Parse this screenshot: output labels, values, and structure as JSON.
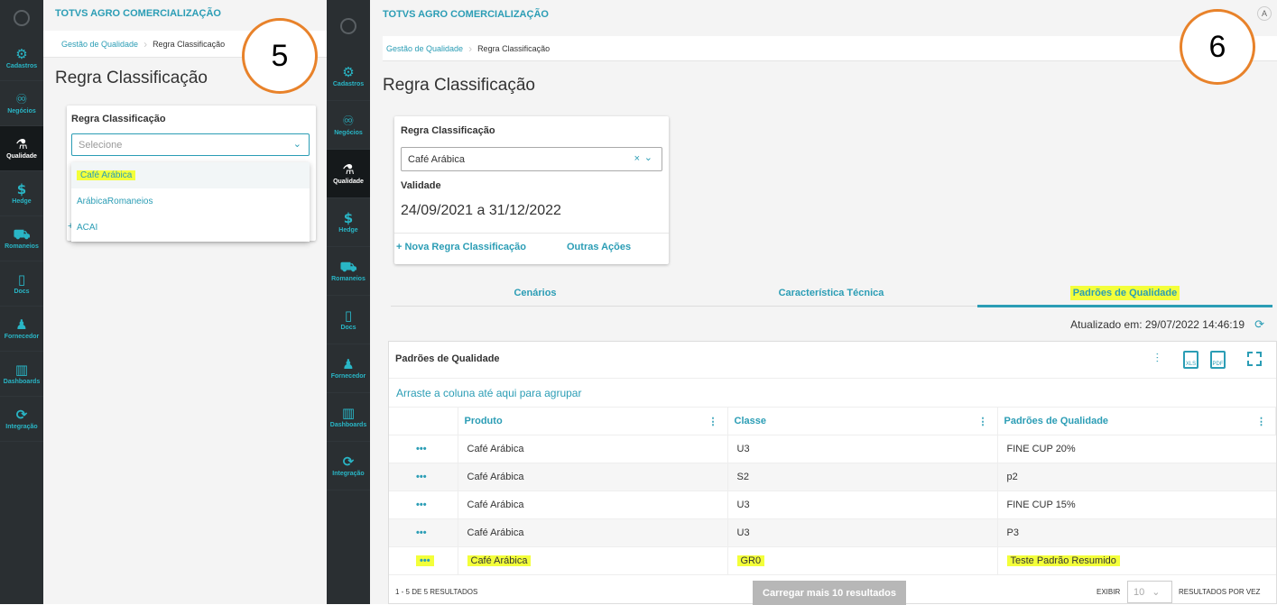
{
  "app_title": "TOTVS AGRO COMERCIALIZAÇÃO",
  "breadcrumb": [
    "Gestão de Qualidade",
    "Regra Classificação"
  ],
  "page_title": "Regra Classificação",
  "sidebar": [
    {
      "label": "Cadastros",
      "icon": "⚙"
    },
    {
      "label": "Negócios",
      "icon": "♾"
    },
    {
      "label": "Qualidade",
      "icon": "⚗"
    },
    {
      "label": "Hedge",
      "icon": "$"
    },
    {
      "label": "Romaneios",
      "icon": "⛟"
    },
    {
      "label": "Docs",
      "icon": "▯"
    },
    {
      "label": "Fornecedor",
      "icon": "♟"
    },
    {
      "label": "Dashboards",
      "icon": "▥"
    },
    {
      "label": "Integração",
      "icon": "⟳"
    }
  ],
  "step5": {
    "number": "5",
    "field_label": "Regra Classificação",
    "placeholder": "Selecione",
    "options": [
      "Café Arábica",
      "ArábicaRomaneios",
      "ACAI"
    ]
  },
  "step6": {
    "number": "6",
    "field_label": "Regra Classificação",
    "selected": "Café Arábica",
    "validity_label": "Validade",
    "validity_value": "24/09/2021 a 31/12/2022",
    "new_rule_link": "+ Nova Regra Classificação",
    "other_actions": "Outras Ações",
    "tabs": [
      "Cenários",
      "Característica Técnica",
      "Padrões de Qualidade"
    ],
    "updated_at": "Atualizado em: 29/07/2022 14:46:19",
    "grid": {
      "title": "Padrões de Qualidade",
      "group_hint": "Arraste a coluna até aqui para agrupar",
      "columns": [
        "Produto",
        "Classe",
        "Padrões de Qualidade"
      ],
      "rows": [
        [
          "Café Arábica",
          "U3",
          "FINE CUP 20%"
        ],
        [
          "Café Arábica",
          "S2",
          "p2"
        ],
        [
          "Café Arábica",
          "U3",
          "FINE CUP 15%"
        ],
        [
          "Café Arábica",
          "U3",
          "P3"
        ],
        [
          "Café Arábica",
          "GR0",
          "Teste Padrão Resumido"
        ]
      ],
      "results_text": "1 - 5 DE 5 RESULTADOS",
      "load_more": "Carregar mais 10 resultados",
      "show_label": "EXIBIR",
      "page_size": "10",
      "per_page_label": "RESULTADOS POR VEZ"
    },
    "avatar": "A"
  },
  "colors": {
    "accent": "#2b9db5",
    "highlight": "#f3ff3a",
    "circle": "#e8822a",
    "sidebar": "#2a2f32"
  }
}
